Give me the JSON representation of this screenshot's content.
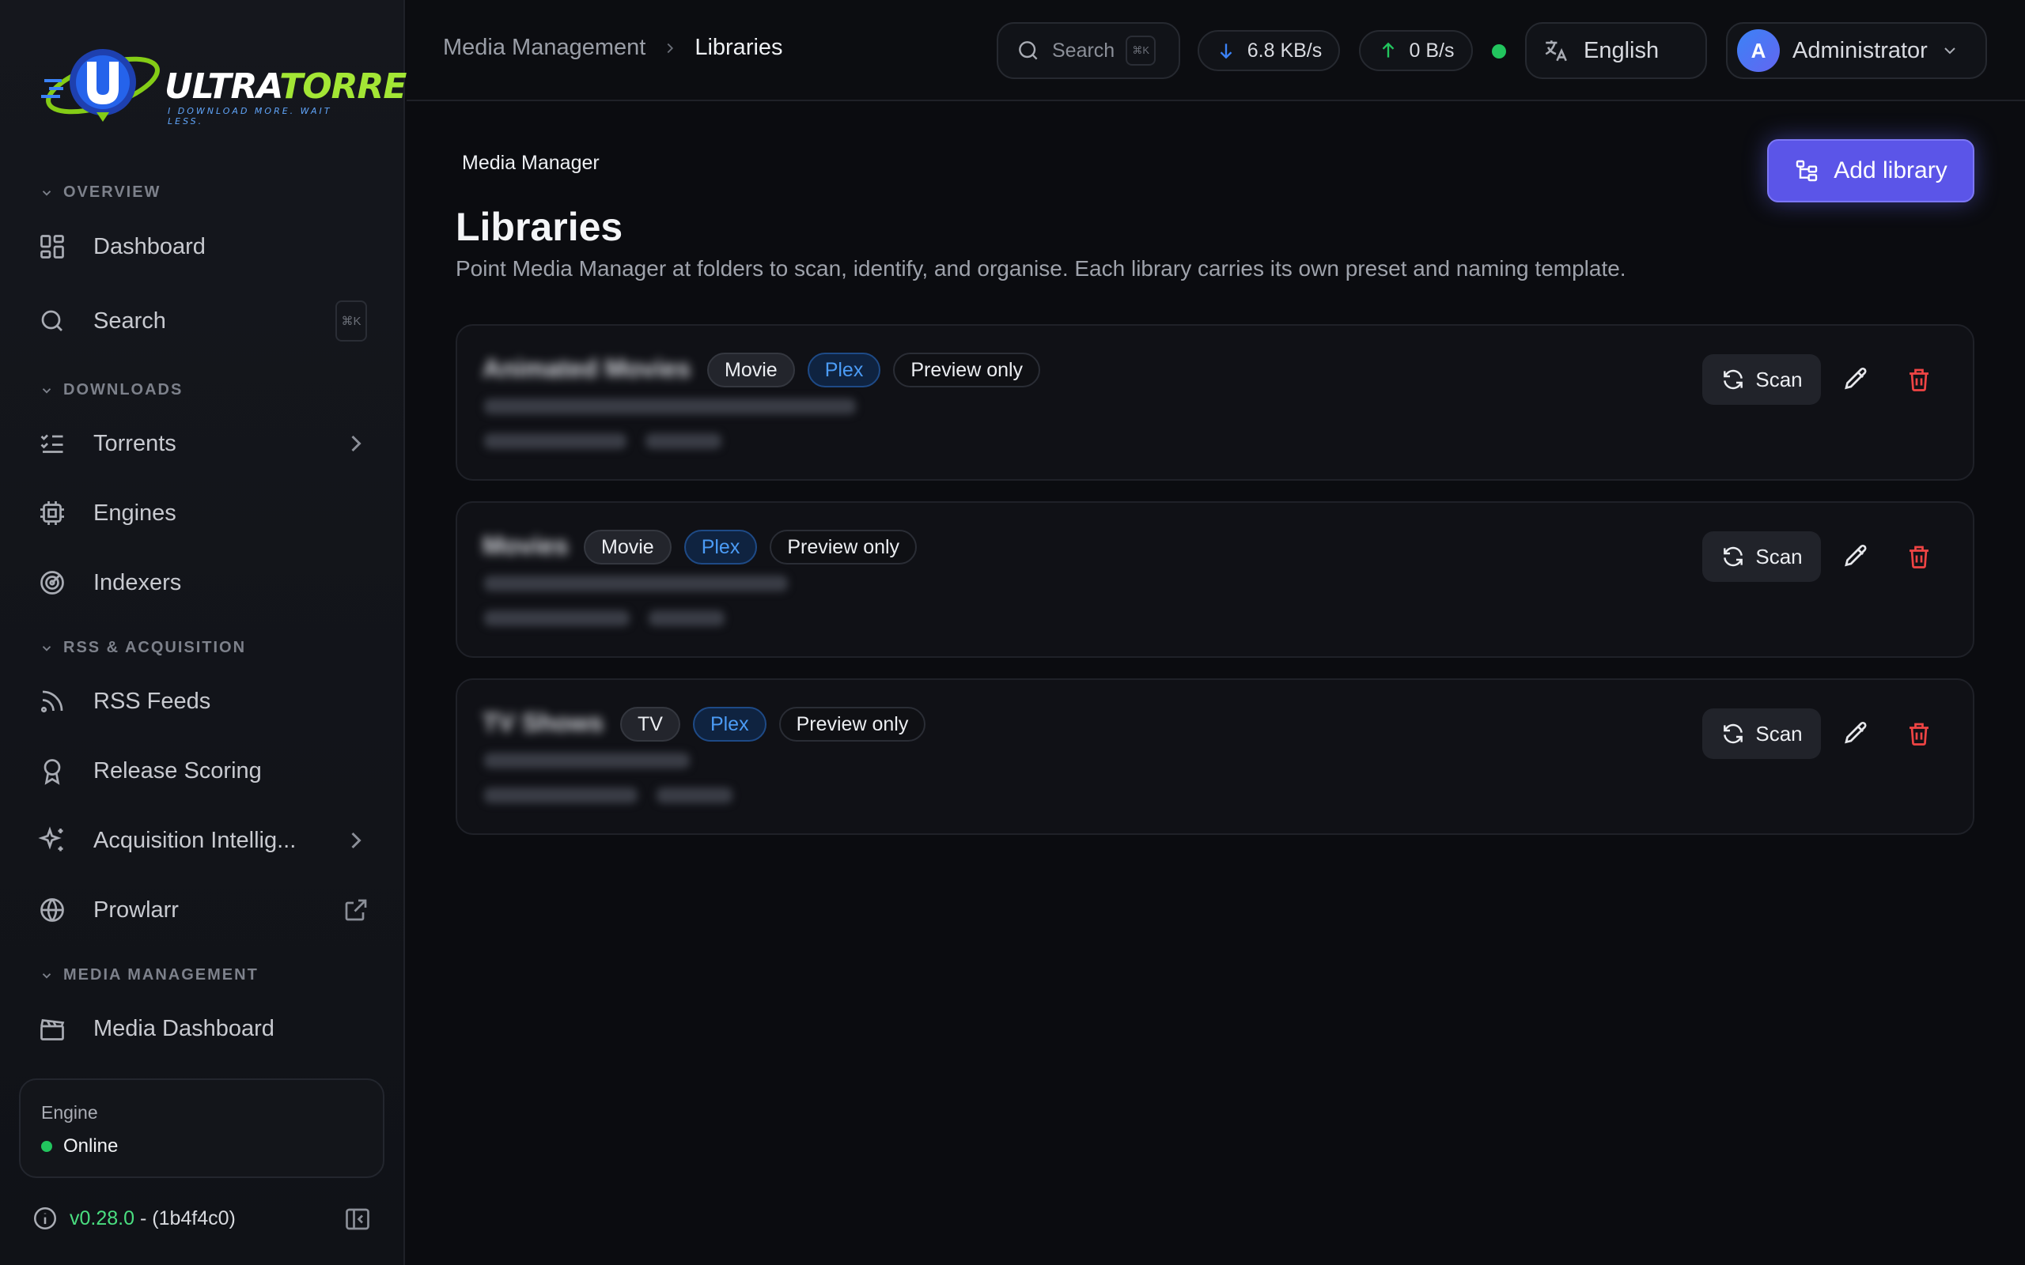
{
  "brand": {
    "name_part1": "ULTRA",
    "name_part2": "TORRENT",
    "tagline": "I DOWNLOAD MORE. WAIT LESS."
  },
  "sidebar": {
    "sections": {
      "overview": "OVERVIEW",
      "downloads": "DOWNLOADS",
      "rss": "RSS & ACQUISITION",
      "media": "MEDIA MANAGEMENT"
    },
    "items": [
      {
        "label": "Dashboard",
        "icon": "dashboard-icon"
      },
      {
        "label": "Search",
        "icon": "search-icon",
        "shortcut": "⌘K"
      },
      {
        "label": "Torrents",
        "icon": "list-check-icon"
      },
      {
        "label": "Engines",
        "icon": "cpu-icon"
      },
      {
        "label": "Indexers",
        "icon": "radar-icon"
      },
      {
        "label": "RSS Feeds",
        "icon": "rss-icon"
      },
      {
        "label": "Release Scoring",
        "icon": "award-icon"
      },
      {
        "label": "Acquisition Intellig...",
        "icon": "sparkles-icon"
      },
      {
        "label": "Prowlarr",
        "icon": "globe-icon"
      },
      {
        "label": "Media Dashboard",
        "icon": "clapperboard-icon"
      }
    ],
    "engine": {
      "title": "Engine",
      "status": "Online",
      "status_color": "#22c55e"
    },
    "version": {
      "number": "v0.28.0",
      "build": "- (1b4f4c0)"
    }
  },
  "topbar": {
    "breadcrumb": {
      "parent": "Media Management",
      "current": "Libraries"
    },
    "search": {
      "label": "Search",
      "shortcut": "⌘K"
    },
    "download_speed": "6.8 KB/s",
    "upload_speed": "0 B/s",
    "language": "English",
    "user": {
      "initial": "A",
      "name": "Administrator"
    }
  },
  "page": {
    "eyebrow": "Media Manager",
    "title": "Libraries",
    "description": "Point Media Manager at folders to scan, identify, and organise. Each library carries its own preset and naming template.",
    "add_button": "Add library",
    "accent": "#5b55e8"
  },
  "libraries": [
    {
      "name": "Animated Movies",
      "type": "Movie",
      "server": "Plex",
      "mode": "Preview only",
      "scan": "Scan"
    },
    {
      "name": "Movies",
      "type": "Movie",
      "server": "Plex",
      "mode": "Preview only",
      "scan": "Scan"
    },
    {
      "name": "TV Shows",
      "type": "TV",
      "server": "Plex",
      "mode": "Preview only",
      "scan": "Scan"
    }
  ]
}
